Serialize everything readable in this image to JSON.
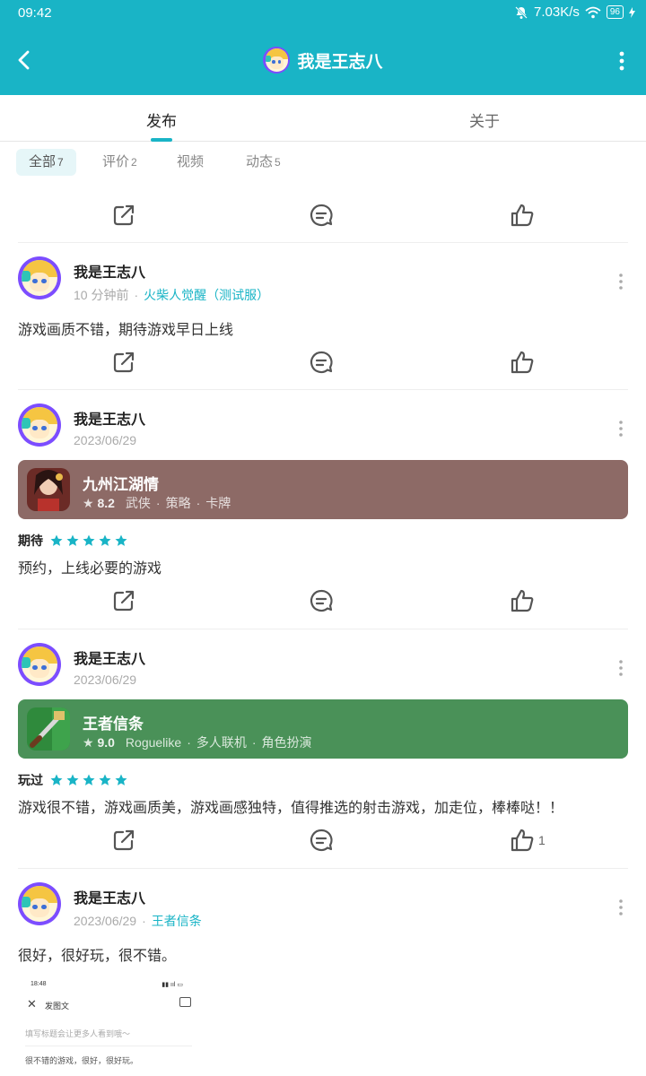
{
  "status_bar": {
    "time": "09:42",
    "network_speed": "7.03K/s",
    "battery": "96"
  },
  "header": {
    "title": "我是王志八"
  },
  "main_tabs": [
    {
      "label": "发布"
    },
    {
      "label": "关于"
    }
  ],
  "sub_tabs": [
    {
      "label": "全部",
      "count": "7"
    },
    {
      "label": "评价",
      "count": "2"
    },
    {
      "label": "视频",
      "count": ""
    },
    {
      "label": "动态",
      "count": "5"
    }
  ],
  "posts": [
    {
      "author": "我是王志八",
      "time": "10 分钟前",
      "game_link": "火柴人觉醒（测试服）",
      "text": "游戏画质不错，期待游戏早日上线",
      "likes": ""
    },
    {
      "author": "我是王志八",
      "time": "2023/06/29",
      "game_card": {
        "name": "九州江湖情",
        "score": "8.2",
        "tags": [
          "武侠",
          "策略",
          "卡牌"
        ],
        "color": "#8d6a66"
      },
      "rating_label": "期待",
      "stars": 5,
      "text": "预约，上线必要的游戏",
      "likes": ""
    },
    {
      "author": "我是王志八",
      "time": "2023/06/29",
      "game_card": {
        "name": "王者信条",
        "score": "9.0",
        "tags": [
          "Roguelike",
          "多人联机",
          "角色扮演"
        ],
        "color": "#4a9158"
      },
      "rating_label": "玩过",
      "stars": 5,
      "text": "游戏很不错，游戏画质美，游戏画感独特，值得推选的射击游戏，加走位，棒棒哒！！",
      "likes": "1"
    },
    {
      "author": "我是王志八",
      "time": "2023/06/29",
      "game_link": "王者信条",
      "text": "很好，很好玩，很不错。",
      "image": {
        "time": "18:48",
        "title": "发图文",
        "placeholder": "填写标题会让更多人看到哦～",
        "content": "很不错的游戏，很好，很好玩。"
      }
    }
  ],
  "colors": {
    "accent": "#19b4c6",
    "star": "#19b4c6"
  }
}
